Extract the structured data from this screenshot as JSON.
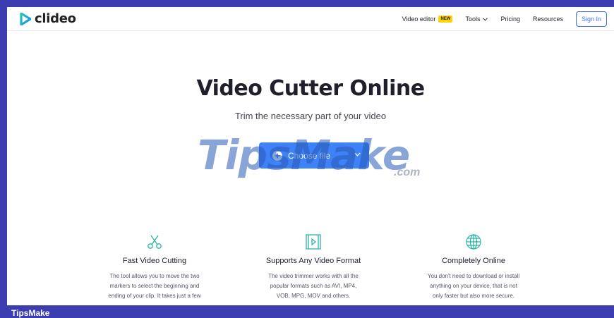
{
  "brand": {
    "name": "clideo"
  },
  "nav": {
    "video_editor": "Video editor",
    "new_badge": "NEW",
    "tools": "Tools",
    "pricing": "Pricing",
    "resources": "Resources",
    "sign_in": "Sign In"
  },
  "hero": {
    "title": "Video Cutter Online",
    "subtitle": "Trim the necessary part of your video",
    "choose_file": "Choose file"
  },
  "watermark": {
    "main": "TipsMake",
    "suffix": ".com"
  },
  "features": [
    {
      "icon": "scissors-icon",
      "title": "Fast Video Cutting",
      "desc": [
        "The tool allows you to move the two",
        "markers to select the beginning and",
        "ending of your clip. It takes just a few"
      ]
    },
    {
      "icon": "video-frame-icon",
      "title": "Supports Any Video Format",
      "desc": [
        "The video trimmer works with all the",
        "popular formats such as AVI, MP4,",
        "VOB, MPG, MOV and others."
      ]
    },
    {
      "icon": "globe-icon",
      "title": "Completely Online",
      "desc": [
        "You don't need to download or install",
        "anything on your device, that is not",
        "only faster but also more secure."
      ]
    }
  ],
  "footer_brand": "TipsMake",
  "colors": {
    "accent": "#3e82f7",
    "frame": "#3b3db0",
    "badge": "#ffd400",
    "icon": "#2bb5a8"
  }
}
